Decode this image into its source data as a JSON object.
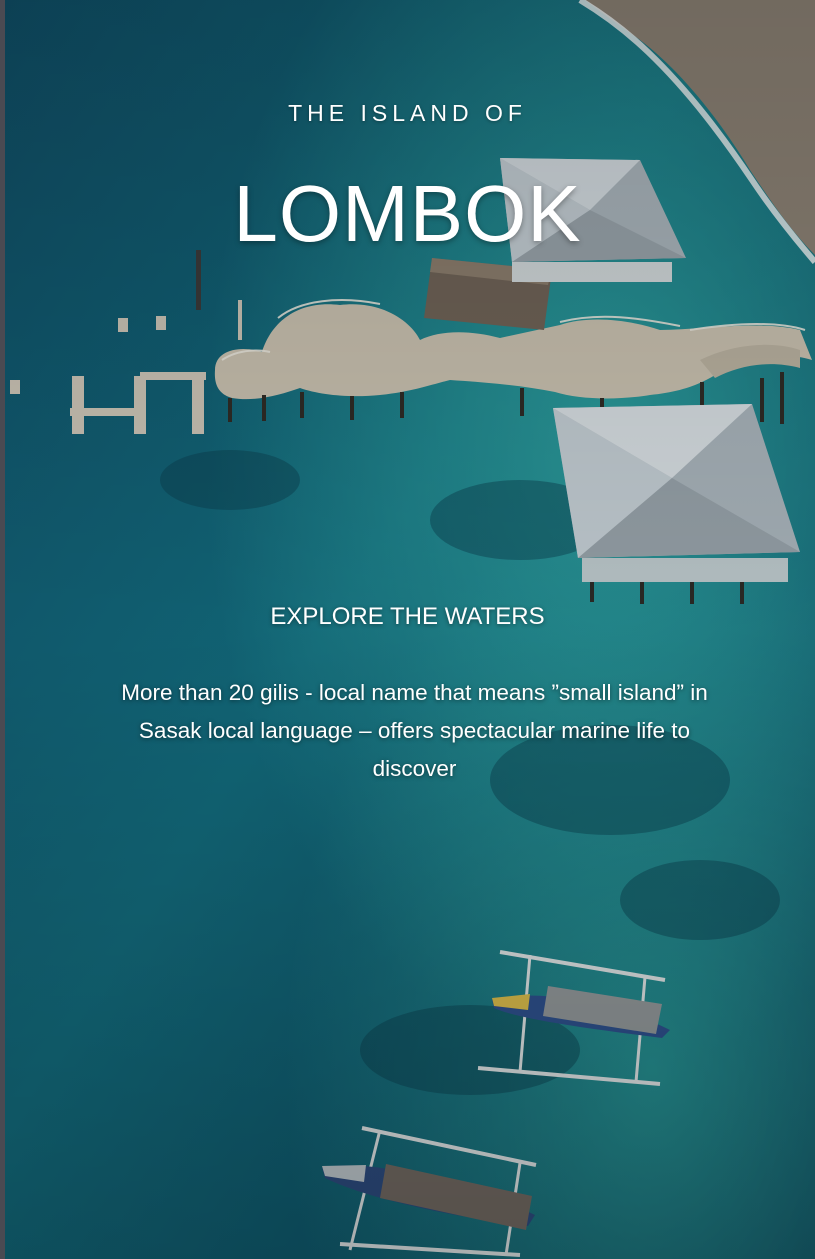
{
  "poster": {
    "kicker": "THE ISLAND OF",
    "title": "LOMBOK",
    "subtitle": "EXPLORE THE WATERS",
    "body": "More than 20 gilis - local name that means ”small island” in Sasak local language – offers spectacular marine life to discover"
  },
  "colors": {
    "deep_water": "#0c3a55",
    "lagoon": "#1d8a92",
    "sand": "#8f8476",
    "roof": "#b9c3c9",
    "text": "#ffffff"
  },
  "icons": [
    "pier-illustration",
    "pavilion-roof",
    "outrigger-boat"
  ]
}
